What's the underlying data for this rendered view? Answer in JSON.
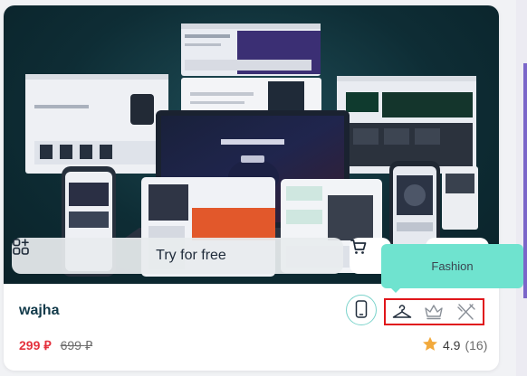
{
  "product": {
    "title": "wajha",
    "price_current": "299",
    "price_original": "699",
    "currency_symbol": "⃁",
    "rating": "4.9",
    "rating_count": "(16)"
  },
  "actions": {
    "try_label": "Try for free"
  },
  "tooltip": {
    "text": "Fashion"
  },
  "categories": [
    {
      "name": "fashion",
      "icon": "hanger-icon"
    },
    {
      "name": "luxury",
      "icon": "crown-icon"
    },
    {
      "name": "restaurants",
      "icon": "fork-knife-icon"
    }
  ],
  "device_icon": "smartphone-icon",
  "colors": {
    "title": "#123a4a",
    "price_current": "#e4313d",
    "tooltip": "#6fe3cf",
    "highlight_border": "#e0161b",
    "device_outline": "#7bd3cb",
    "hero_background": "#0e2d35",
    "star": "#f2a93b"
  }
}
